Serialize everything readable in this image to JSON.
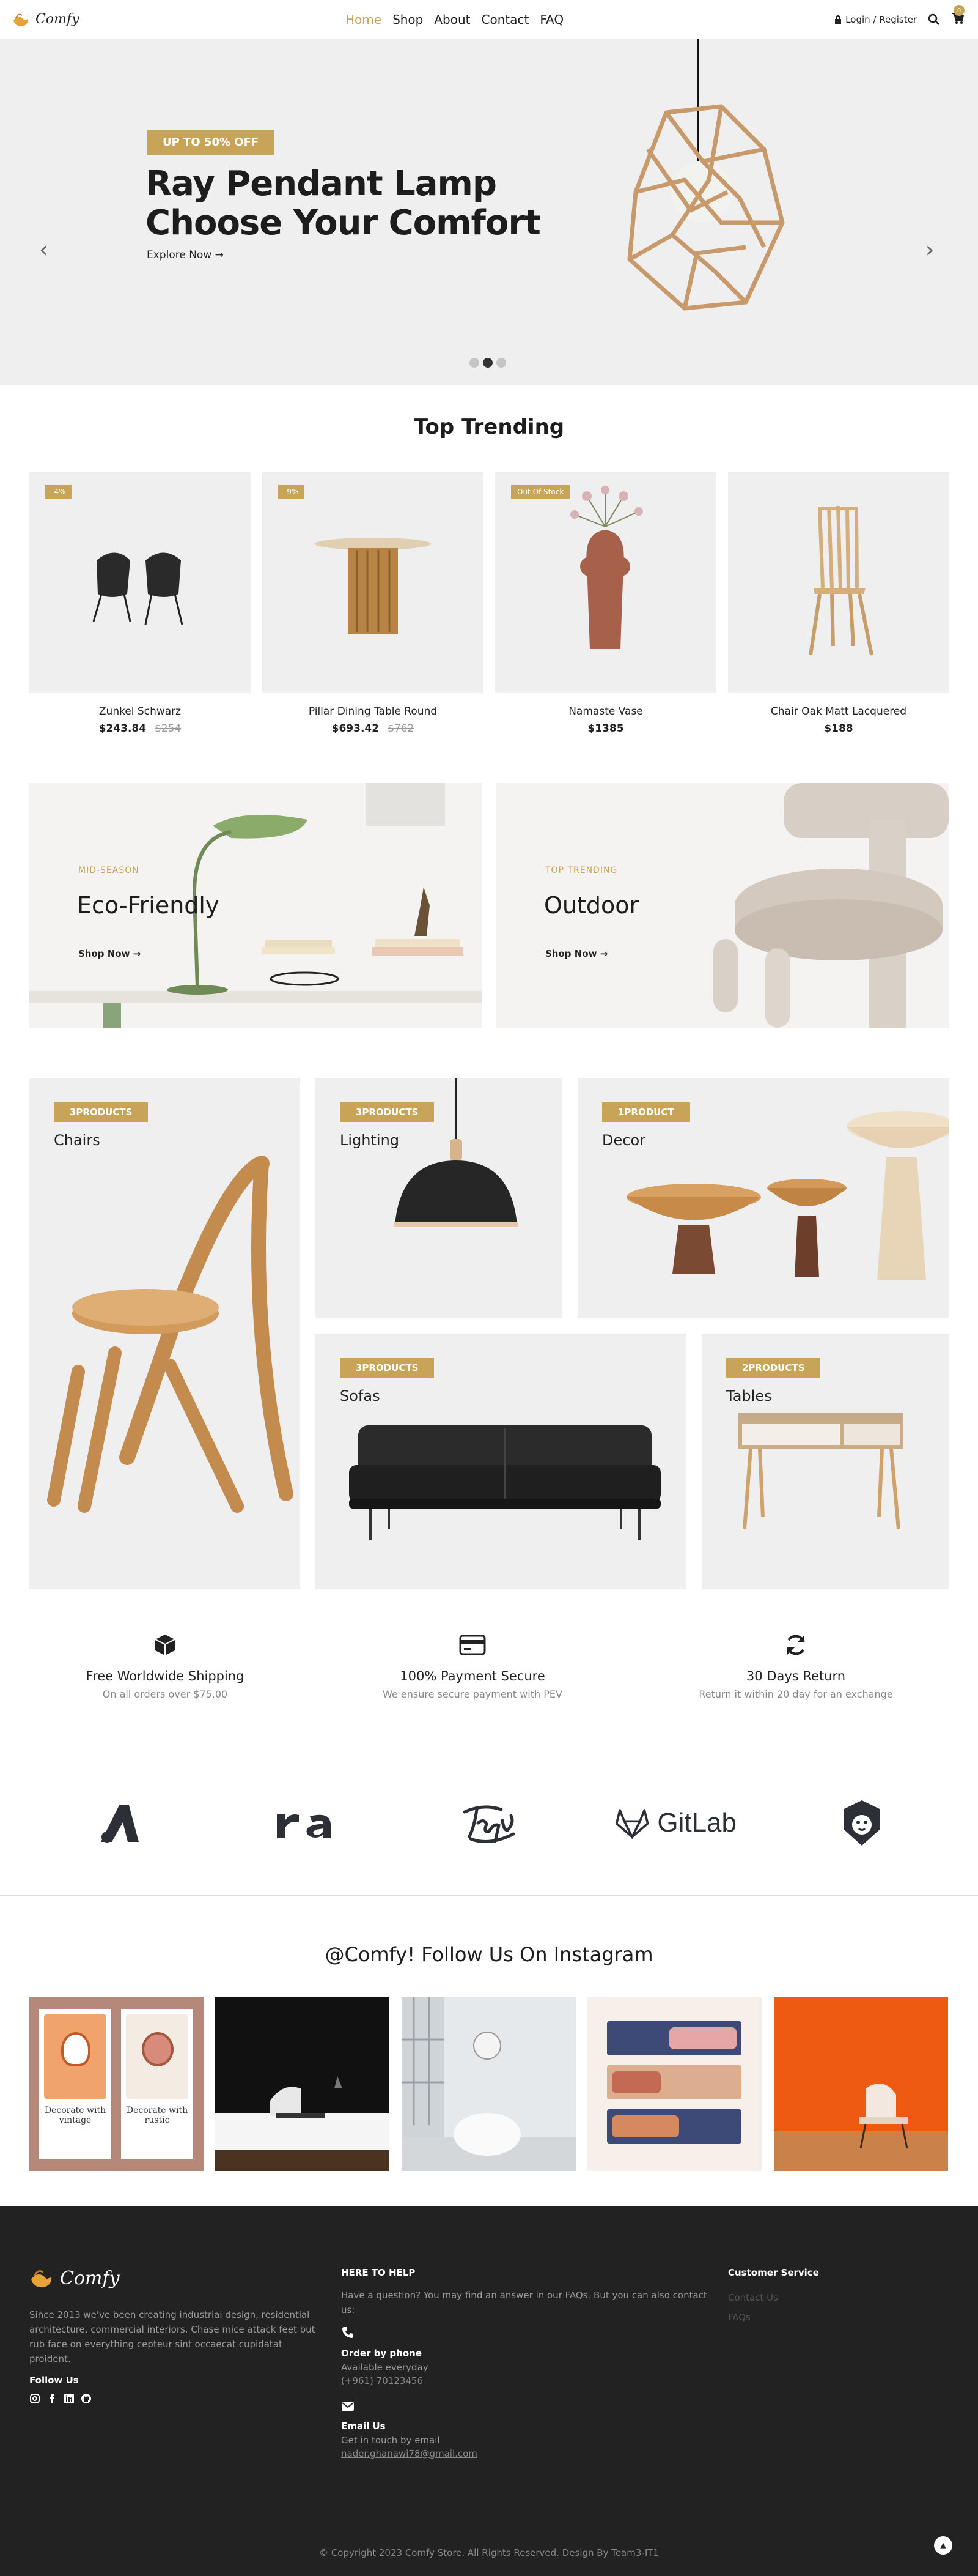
{
  "header": {
    "logo_text": "Comfy",
    "nav": [
      "Home",
      "Shop",
      "About",
      "Contact",
      "FAQ"
    ],
    "login_label": "Login / Register",
    "cart_count": "0"
  },
  "hero": {
    "badge": "UP TO 50% OFF",
    "title_line1": "Ray Pendant Lamp",
    "title_line2": "Choose Your Comfort",
    "explore": "Explore Now →",
    "slides": 3,
    "active_slide": 2
  },
  "trending": {
    "title": "Top Trending",
    "products": [
      {
        "tag": "-4%",
        "name": "Zunkel Schwarz",
        "price": "$243.84",
        "old_price": "$254"
      },
      {
        "tag": "-9%",
        "name": "Pillar Dining Table Round",
        "price": "$693.42",
        "old_price": "$762"
      },
      {
        "tag": "Out Of Stock",
        "name": "Namaste Vase",
        "price": "$1385",
        "old_price": ""
      },
      {
        "tag": "",
        "name": "Chair Oak Matt Lacquered",
        "price": "$188",
        "old_price": ""
      }
    ]
  },
  "banners": [
    {
      "sub": "MID-SEASON",
      "title": "Eco-Friendly",
      "cta": "Shop Now →"
    },
    {
      "sub": "TOP TRENDING",
      "title": "Outdoor",
      "cta": "Shop Now →"
    }
  ],
  "categories": [
    {
      "count": "3PRODUCTS",
      "name": "Chairs"
    },
    {
      "count": "3PRODUCTS",
      "name": "Lighting"
    },
    {
      "count": "1PRODUCT",
      "name": "Decor"
    },
    {
      "count": "3PRODUCTS",
      "name": "Sofas"
    },
    {
      "count": "2PRODUCTS",
      "name": "Tables"
    }
  ],
  "features": [
    {
      "icon": "box-icon",
      "title": "Free Worldwide Shipping",
      "desc": "On all orders over $75.00"
    },
    {
      "icon": "credit-card-icon",
      "title": "100% Payment Secure",
      "desc": "We ensure secure payment with PEV"
    },
    {
      "icon": "refresh-icon",
      "title": "30 Days Return",
      "desc": "Return it within 20 day for an exchange"
    }
  ],
  "brands": [
    "brand-a-logo",
    "brand-ra-logo",
    "brand-script-logo",
    "GitLab",
    "brand-lion-logo"
  ],
  "instagram": {
    "title": "@Comfy! Follow Us On Instagram",
    "card1_text1": "Decorate with vintage",
    "card1_text2": "Decorate with rustic"
  },
  "footer": {
    "logo_text": "Comfy",
    "about": "Since 2013 we've been creating industrial design, residential architecture, commercial interiors. Chase mice attack feet but rub face on everything cepteur sint occaecat cupidatat proident.",
    "follow": "Follow Us",
    "help_title": "HERE TO HELP",
    "help_text": "Have a question? You may find an answer in our FAQs. But you can also contact us:",
    "phone_title": "Order by phone",
    "phone_sub": "Available everyday",
    "phone": "(+961) 70123456",
    "email_title": "Email Us",
    "email_sub": "Get in touch by email",
    "email": "nader.ghanawi78@gmail.com",
    "service_title": "Customer Service",
    "service_links": [
      "Contact Us",
      "FAQs"
    ],
    "copyright": "© Copyright 2023 Comfy Store. All Rights Reserved. Design By Team3-IT1"
  },
  "colors": {
    "accent": "#c7a457",
    "footer_bg": "#222222",
    "panel_bg": "#efefef"
  }
}
